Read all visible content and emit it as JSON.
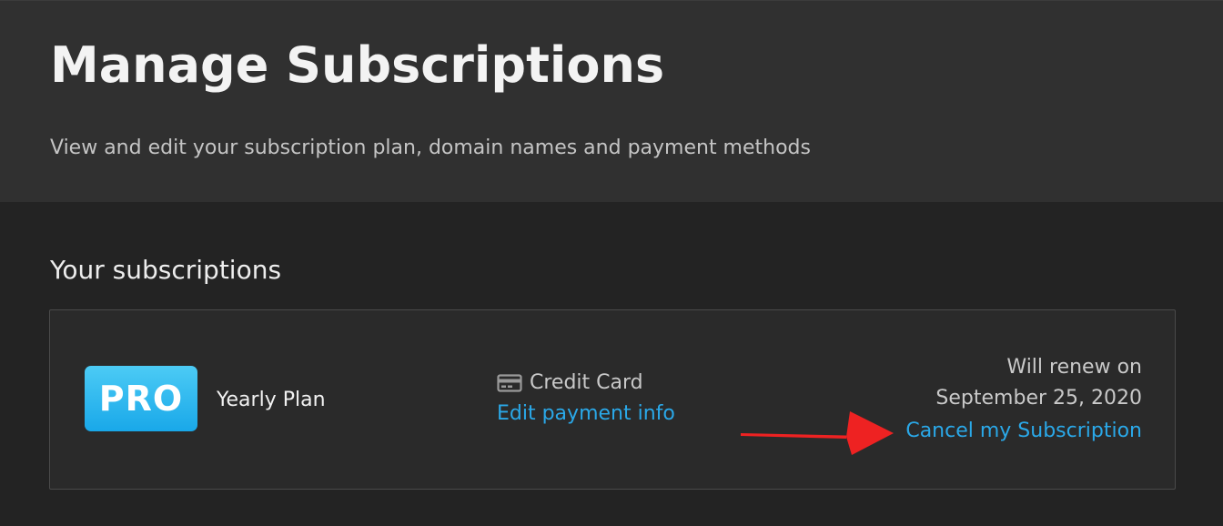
{
  "header": {
    "title": "Manage Subscriptions",
    "subtitle": "View and edit your subscription plan, domain names and payment methods"
  },
  "main": {
    "section_title": "Your subscriptions",
    "subscription": {
      "badge": "PRO",
      "plan_name": "Yearly Plan",
      "payment_method": "Credit Card",
      "edit_payment_label": "Edit payment info",
      "renew_label": "Will renew on",
      "renew_date": "September 25, 2020",
      "cancel_label": "Cancel my Subscription"
    }
  },
  "icons": {
    "payment": "credit-card-icon",
    "annotation": "red-arrow-icon"
  },
  "colors": {
    "link": "#2aa8e8",
    "badge": "#1fb0ec",
    "annotation_arrow": "#ee2222"
  }
}
